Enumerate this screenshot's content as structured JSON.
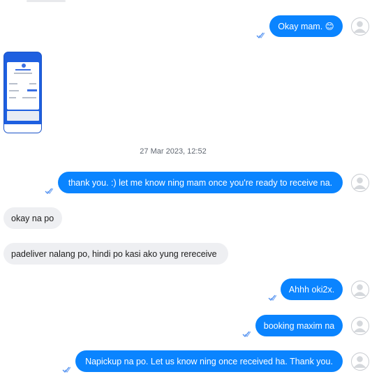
{
  "colors": {
    "outgoing_bubble": "#0a84ff",
    "incoming_bubble": "#eeeff2",
    "read_tick": "#4a8cf0",
    "phone_blue": "#1e5fe0"
  },
  "divider": {
    "timestamp": "27 Mar 2023, 12:52"
  },
  "messages": [
    {
      "direction": "outgoing",
      "text": "Okay mam. 😊"
    },
    {
      "direction": "incoming",
      "type": "image",
      "icon": "payment-receipt-screenshot"
    },
    {
      "direction": "outgoing",
      "text": "thank you. :) let me know ning mam once you're ready to receive na."
    },
    {
      "direction": "incoming",
      "text": "okay na po"
    },
    {
      "direction": "incoming",
      "text": "padeliver nalang po, hindi po kasi ako yung rereceive"
    },
    {
      "direction": "outgoing",
      "text": "Ahhh oki2x."
    },
    {
      "direction": "outgoing",
      "text": "booking maxim na"
    },
    {
      "direction": "outgoing",
      "text": "Napickup na po. Let us know ning once received ha. Thank you."
    }
  ]
}
